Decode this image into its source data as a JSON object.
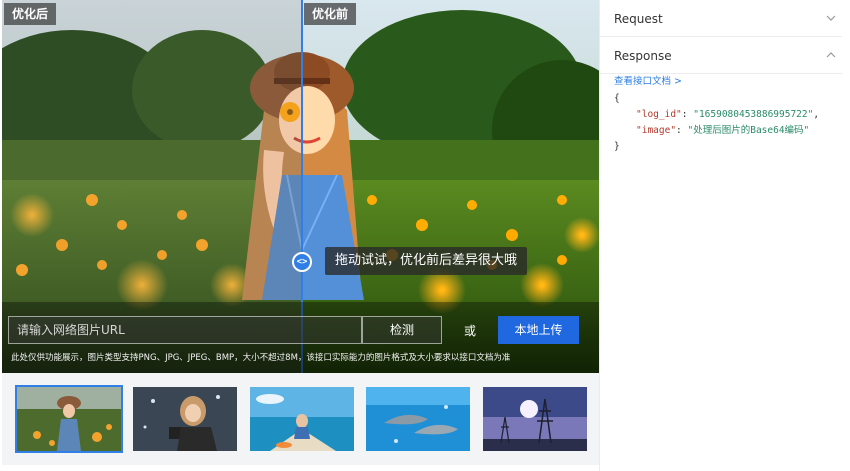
{
  "demo": {
    "after_label": "优化后",
    "before_label": "优化前",
    "handle_glyph": "<>",
    "hint": "拖动试试，优化前后差异很大哦",
    "url_placeholder": "请输入网络图片URL",
    "detect_label": "检测",
    "or_label": "或",
    "upload_label": "本地上传",
    "disclaimer": "此处仅供功能展示，图片类型支持PNG、JPG、JPEG、BMP，大小不超过8M，该接口实际能力的图片格式及大小要求以接口文档为准",
    "divider_position_percent": 50
  },
  "thumbnails": [
    {
      "name": "girl-in-flower-field",
      "selected": true
    },
    {
      "name": "girl-with-camera-in-snow",
      "selected": false
    },
    {
      "name": "girl-on-boat",
      "selected": false
    },
    {
      "name": "dolphins-underwater",
      "selected": false
    },
    {
      "name": "power-tower-sunset",
      "selected": false
    }
  ],
  "panel": {
    "request_title": "Request",
    "response_title": "Response",
    "docs_link": "查看接口文档 >",
    "json_open": "{",
    "json_close": "}",
    "fields": [
      {
        "key": "\"log_id\"",
        "sep": ": ",
        "value": "\"1659080453886995722\"",
        "tail": ","
      },
      {
        "key": "\"image\"",
        "sep": ": ",
        "value": "\"处理后图片的Base64编码\"",
        "tail": ""
      }
    ]
  },
  "colors": {
    "accent": "#2f7fe6",
    "upload_button": "#2068e0",
    "json_key": "#b03a2e",
    "json_value": "#2a8a6a"
  },
  "icons": {
    "request_toggle": "chevron-down-icon",
    "response_toggle": "chevron-up-icon",
    "compare_handle": "drag-handle-icon"
  }
}
